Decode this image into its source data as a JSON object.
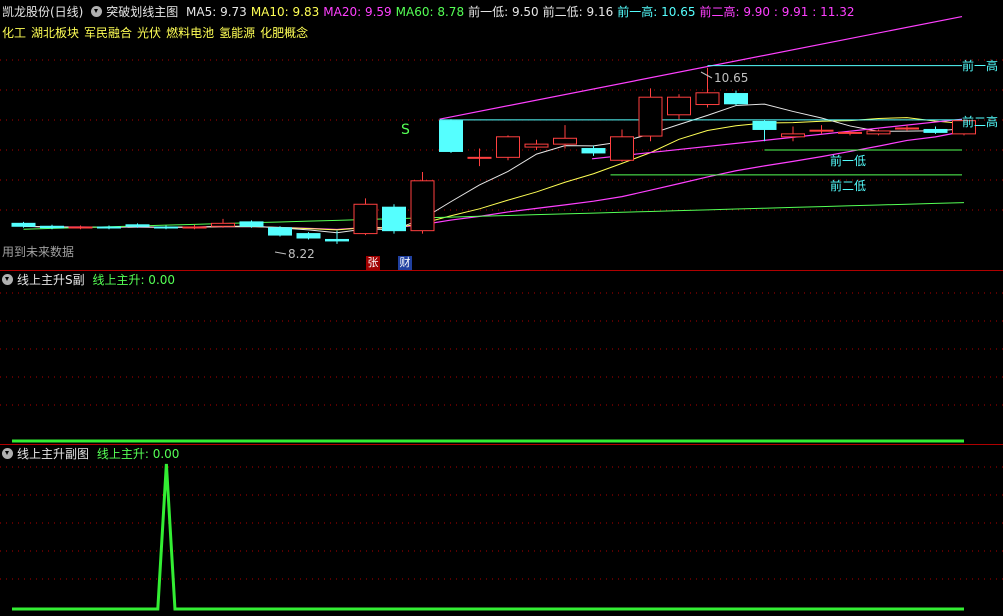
{
  "main": {
    "stock_name": "凯龙股份(日线)",
    "indicator": "突破划线主图",
    "ma": [
      {
        "label": "MA5: 9.73",
        "color": "#e6e6e6"
      },
      {
        "label": "MA10: 9.83",
        "color": "#ffff55"
      },
      {
        "label": "MA20: 9.59",
        "color": "#ff40ff"
      },
      {
        "label": "MA60: 8.78",
        "color": "#55ff55"
      },
      {
        "label": "前一低: 9.50",
        "color": "#e6e6e6"
      },
      {
        "label": "前二低: 9.16",
        "color": "#e6e6e6"
      },
      {
        "label": "前一高: 10.65",
        "color": "#55ffff"
      },
      {
        "label": "前二高: 9.90 : 9.91 : 11.32",
        "color": "#ff40ff"
      }
    ],
    "concepts": [
      "化工",
      "湖北板块",
      "军民融合",
      "光伏",
      "燃料电池",
      "氢能源",
      "化肥概念"
    ],
    "future_data_note": "用到未来数据",
    "labels": {
      "prev_high1": "前一高",
      "prev_high2": "前二高",
      "prev_low1": "前一低",
      "prev_low2": "前二低",
      "max_price": "10.65",
      "min_price": "8.22",
      "signal": "S",
      "tag_zhang": "张",
      "tag_cai": "财"
    }
  },
  "sub1": {
    "title": "线上主升S副",
    "value_label": "线上主升: 0.00"
  },
  "sub2": {
    "title": "线上主升副图",
    "value_label": "线上主升: 0.00"
  },
  "colors": {
    "up": "#ff4040",
    "down": "#55ffff",
    "grid": "#b00000",
    "signal_line": "#33ee33"
  },
  "chart_data": {
    "type": "candlestick",
    "candles": [
      {
        "o": 8.5,
        "c": 8.46,
        "h": 8.52,
        "l": 8.44
      },
      {
        "o": 8.46,
        "c": 8.44,
        "h": 8.48,
        "l": 8.42
      },
      {
        "o": 8.44,
        "c": 8.45,
        "h": 8.47,
        "l": 8.42
      },
      {
        "o": 8.45,
        "c": 8.44,
        "h": 8.47,
        "l": 8.42
      },
      {
        "o": 8.48,
        "c": 8.46,
        "h": 8.5,
        "l": 8.44
      },
      {
        "o": 8.45,
        "c": 8.44,
        "h": 8.47,
        "l": 8.42
      },
      {
        "o": 8.44,
        "c": 8.45,
        "h": 8.48,
        "l": 8.42
      },
      {
        "o": 8.46,
        "c": 8.5,
        "h": 8.56,
        "l": 8.44
      },
      {
        "o": 8.52,
        "c": 8.46,
        "h": 8.54,
        "l": 8.44
      },
      {
        "o": 8.44,
        "c": 8.34,
        "h": 8.46,
        "l": 8.32
      },
      {
        "o": 8.36,
        "c": 8.3,
        "h": 8.38,
        "l": 8.28
      },
      {
        "o": 8.28,
        "c": 8.26,
        "h": 8.4,
        "l": 8.22
      },
      {
        "o": 8.36,
        "c": 8.76,
        "h": 8.84,
        "l": 8.34
      },
      {
        "o": 8.72,
        "c": 8.4,
        "h": 8.76,
        "l": 8.36
      },
      {
        "o": 8.4,
        "c": 9.08,
        "h": 9.2,
        "l": 8.36
      },
      {
        "o": 9.9,
        "c": 9.48,
        "h": 9.92,
        "l": 9.46
      },
      {
        "o": 9.4,
        "c": 9.4,
        "h": 9.52,
        "l": 9.28
      },
      {
        "o": 9.4,
        "c": 9.68,
        "h": 9.7,
        "l": 9.36
      },
      {
        "o": 9.54,
        "c": 9.58,
        "h": 9.64,
        "l": 9.5
      },
      {
        "o": 9.58,
        "c": 9.66,
        "h": 9.84,
        "l": 9.52
      },
      {
        "o": 9.52,
        "c": 9.46,
        "h": 9.56,
        "l": 9.42
      },
      {
        "o": 9.36,
        "c": 9.68,
        "h": 9.78,
        "l": 9.34
      },
      {
        "o": 9.69,
        "c": 10.22,
        "h": 10.34,
        "l": 9.62
      },
      {
        "o": 9.98,
        "c": 10.22,
        "h": 10.26,
        "l": 9.92
      },
      {
        "o": 10.12,
        "c": 10.28,
        "h": 10.62,
        "l": 10.08
      },
      {
        "o": 10.27,
        "c": 10.13,
        "h": 10.31,
        "l": 10.11
      },
      {
        "o": 9.89,
        "c": 9.78,
        "h": 9.91,
        "l": 9.62
      },
      {
        "o": 9.68,
        "c": 9.72,
        "h": 9.82,
        "l": 9.62
      },
      {
        "o": 9.76,
        "c": 9.77,
        "h": 9.84,
        "l": 9.72
      },
      {
        "o": 9.74,
        "c": 9.74,
        "h": 9.76,
        "l": 9.7
      },
      {
        "o": 9.72,
        "c": 9.76,
        "h": 9.78,
        "l": 9.7
      },
      {
        "o": 9.8,
        "c": 9.8,
        "h": 9.84,
        "l": 9.76
      },
      {
        "o": 9.78,
        "c": 9.74,
        "h": 9.82,
        "l": 9.72
      },
      {
        "o": 9.72,
        "c": 9.9,
        "h": 9.92,
        "l": 9.7
      }
    ],
    "ma": {
      "MA5": 9.73,
      "MA10": 9.83,
      "MA20": 9.59,
      "MA60": 8.78
    },
    "levels": {
      "prev_high1": 10.65,
      "prev_high2": 9.91,
      "prev_low1": 9.5,
      "prev_low2": 9.16
    },
    "sub1_series": [
      0,
      0,
      0,
      0,
      0,
      0,
      0,
      0,
      0,
      0,
      0,
      0,
      0,
      0,
      0,
      0,
      0,
      0,
      0,
      0,
      0,
      0,
      0,
      0,
      0,
      0,
      0,
      0,
      0,
      0,
      0,
      0,
      0,
      0
    ],
    "sub2_series": [
      0,
      0,
      0,
      0,
      0,
      0,
      0,
      0,
      0,
      0,
      0,
      0,
      0,
      0,
      0,
      0,
      0,
      0,
      1,
      0,
      0,
      0,
      0,
      0,
      0,
      0,
      0,
      0,
      0,
      0,
      0,
      0,
      0,
      0,
      0,
      0,
      0,
      0,
      0,
      0,
      0,
      0,
      0,
      0,
      0,
      0,
      0,
      0,
      0,
      0,
      0,
      0,
      0,
      0,
      0,
      0,
      0,
      0,
      0,
      0,
      0,
      0,
      0,
      0,
      0,
      0,
      0,
      0,
      0,
      0,
      0,
      0,
      0,
      0,
      0,
      0,
      0,
      0,
      0,
      0,
      0,
      0,
      0,
      0,
      0,
      0,
      0,
      0,
      0,
      0,
      0,
      0,
      0,
      0,
      0,
      0,
      0,
      0,
      0,
      0,
      0,
      0,
      0,
      0,
      0,
      0,
      0,
      0,
      0,
      0,
      0,
      0
    ]
  }
}
